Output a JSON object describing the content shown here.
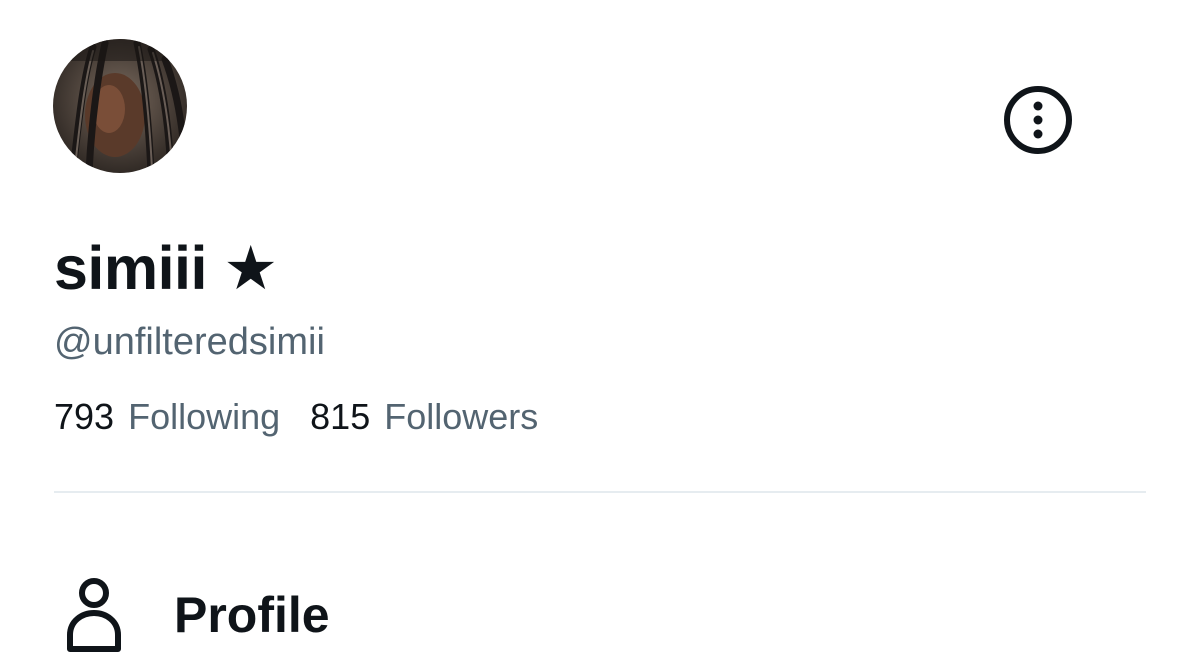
{
  "profile": {
    "display_name": "simiii ★",
    "handle": "@unfilteredsimii",
    "avatar_icon": "user-avatar-photo"
  },
  "stats": {
    "following_count": "793",
    "following_label": "Following",
    "followers_count": "815",
    "followers_label": "Followers"
  },
  "header": {
    "more_icon": "more-options-icon"
  },
  "nav": {
    "items": [
      {
        "label": "Profile",
        "icon": "person-icon"
      }
    ]
  },
  "colors": {
    "primary_text": "#0f1419",
    "secondary_text": "#536471",
    "divider": "#e6ecf0",
    "background": "#ffffff"
  }
}
